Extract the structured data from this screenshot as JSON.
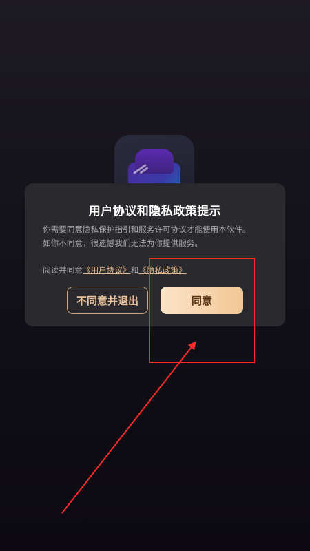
{
  "dialog": {
    "title": "用户协议和隐私政策提示",
    "body_line1": "你需要同意隐私保护指引和服务许可协议才能使用本软件。",
    "body_line2": "如你不同意，很遗憾我们无法为你提供服务。",
    "agree_prefix": "阅读并同意",
    "user_agreement_link": "《用户协议》",
    "agree_conjunction": "和",
    "privacy_policy_link": "《隐私政策》",
    "decline_button": "不同意并退出",
    "agree_button": "同意"
  },
  "colors": {
    "dialog_background": "#2a2a2e",
    "accent_gold": "#e6b98a",
    "agree_gradient_start": "#fbe3c7",
    "agree_gradient_end": "#f3c795",
    "annotation_red": "#ff2a2a"
  },
  "icons": {
    "app_icon": "app-logo-icon"
  }
}
